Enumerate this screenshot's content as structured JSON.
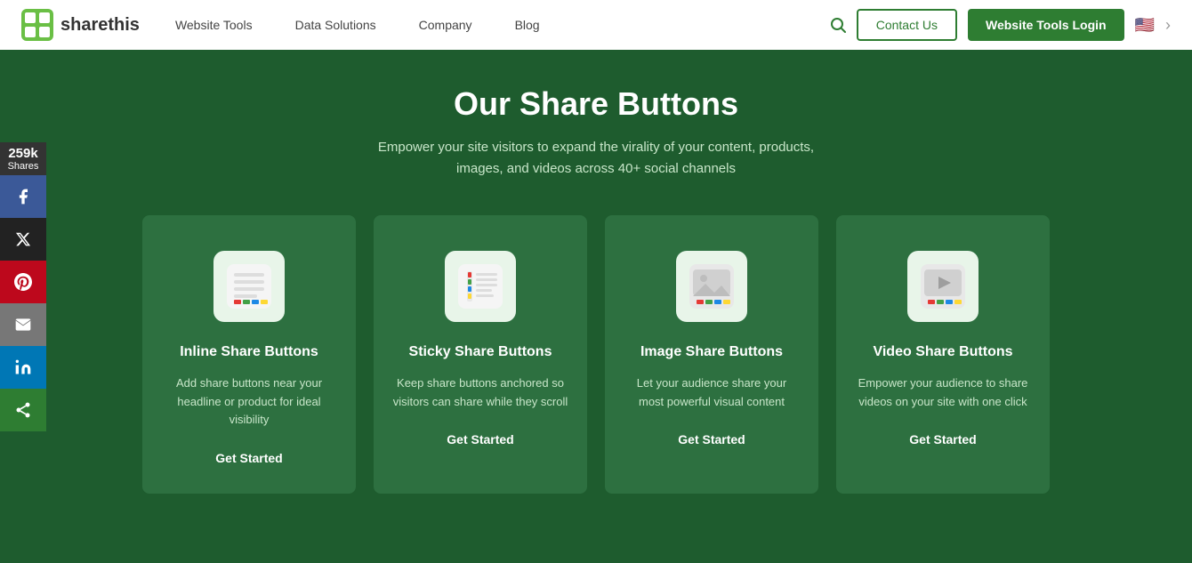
{
  "navbar": {
    "logo_text": "sharethis",
    "nav_links": [
      {
        "label": "Website Tools"
      },
      {
        "label": "Data Solutions"
      },
      {
        "label": "Company"
      },
      {
        "label": "Blog"
      }
    ],
    "contact_label": "Contact Us",
    "login_label": "Website Tools Login"
  },
  "hero": {
    "title": "Our Share Buttons",
    "subtitle": "Empower your site visitors to expand the virality of your content, products, images, and videos across 40+ social channels"
  },
  "sidebar": {
    "count": "259k",
    "shares_label": "Shares"
  },
  "cards": [
    {
      "title": "Inline Share Buttons",
      "desc": "Add share buttons near your headline or product for ideal visibility",
      "cta": "Get Started",
      "icon_type": "inline"
    },
    {
      "title": "Sticky Share Buttons",
      "desc": "Keep share buttons anchored so visitors can share while they scroll",
      "cta": "Get Started",
      "icon_type": "sticky"
    },
    {
      "title": "Image Share Buttons",
      "desc": "Let your audience share your most powerful visual content",
      "cta": "Get Started",
      "icon_type": "image"
    },
    {
      "title": "Video Share Buttons",
      "desc": "Empower your audience to share videos on your site with one click",
      "cta": "Get Started",
      "icon_type": "video"
    }
  ]
}
